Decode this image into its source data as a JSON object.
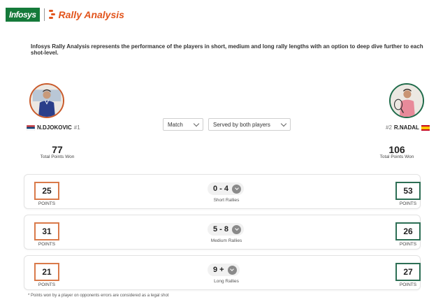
{
  "brand": {
    "company": "Infosys",
    "product": "Rally Analysis",
    "accent": "#e2541c",
    "company_color": "#157a3a"
  },
  "intro": "Infosys Rally Analysis represents the performance of the players in short, medium and long rally lengths with an option to deep dive further to each shot-level.",
  "player1": {
    "name": "N.DJOKOVIC",
    "rank": "#1",
    "flag": "serbia-flag-icon",
    "total_points": "77",
    "total_label": "Total Points Won",
    "color": "#d97a4a"
  },
  "player2": {
    "name": "R.NADAL",
    "rank": "#2",
    "flag": "spain-flag-icon",
    "total_points": "106",
    "total_label": "Total Points Won",
    "color": "#2d6f55"
  },
  "filters": {
    "scope": "Match",
    "serve": "Served by both players"
  },
  "rallies": [
    {
      "range": "0 - 4",
      "name": "Short Rallies",
      "p1_points": "25",
      "p2_points": "53",
      "points_label": "POINTS"
    },
    {
      "range": "5 - 8",
      "name": "Medium Rallies",
      "p1_points": "31",
      "p2_points": "26",
      "points_label": "POINTS"
    },
    {
      "range": "9 +",
      "name": "Long Rallies",
      "p1_points": "21",
      "p2_points": "27",
      "points_label": "POINTS"
    }
  ],
  "footnote": "* Points won by a player on opponents errors are considered as a legal shot"
}
